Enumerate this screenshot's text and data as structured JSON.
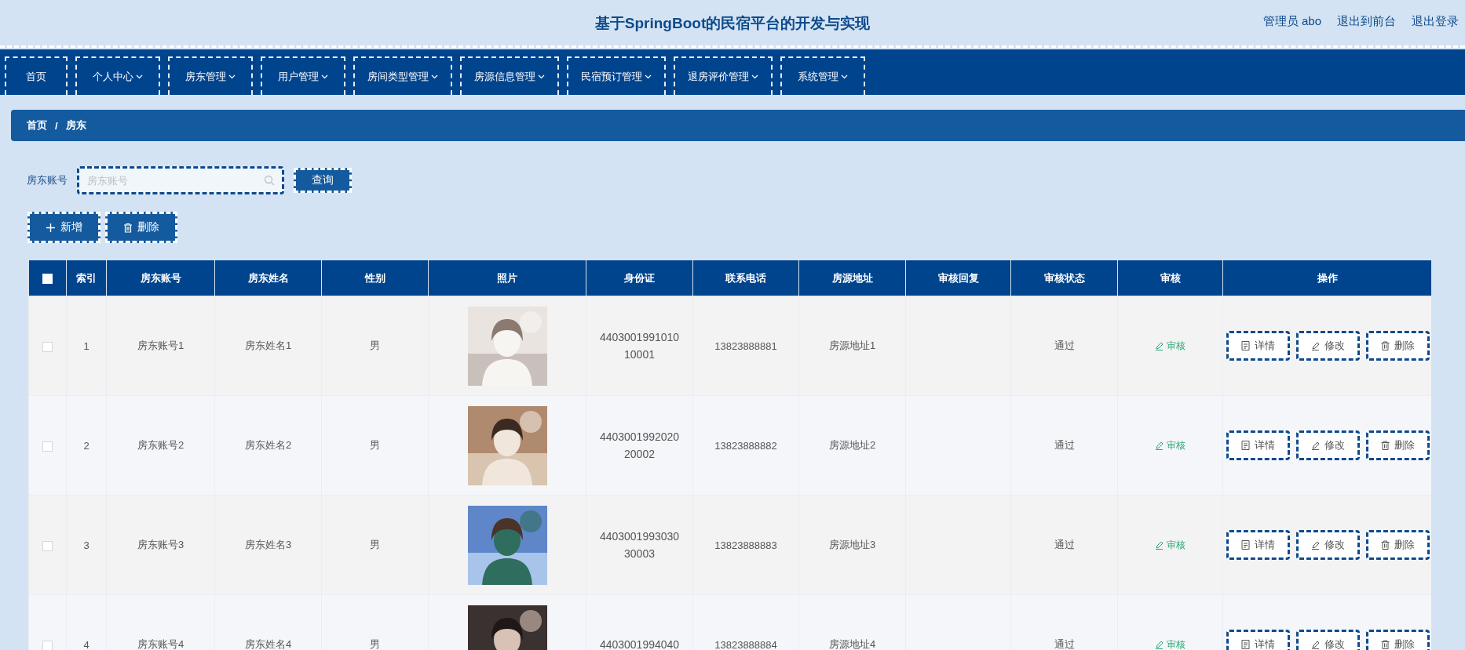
{
  "header": {
    "title": "基于SpringBoot的民宿平台的开发与实现",
    "links": [
      "管理员 abo",
      "退出到前台",
      "退出登录"
    ]
  },
  "nav": [
    {
      "label": "首页",
      "has_menu": false
    },
    {
      "label": "个人中心",
      "has_menu": true
    },
    {
      "label": "房东管理",
      "has_menu": true
    },
    {
      "label": "用户管理",
      "has_menu": true
    },
    {
      "label": "房间类型管理",
      "has_menu": true
    },
    {
      "label": "房源信息管理",
      "has_menu": true
    },
    {
      "label": "民宿预订管理",
      "has_menu": true
    },
    {
      "label": "退房评价管理",
      "has_menu": true
    },
    {
      "label": "系统管理",
      "has_menu": true
    }
  ],
  "breadcrumb": {
    "items": [
      "首页",
      "房东"
    ],
    "separator": "/"
  },
  "search": {
    "label": "房东账号",
    "placeholder": "房东账号",
    "button": "查询"
  },
  "actions": [
    {
      "kind": "add",
      "label": "新增"
    },
    {
      "kind": "delete",
      "label": "删除"
    }
  ],
  "table": {
    "all_checked": false,
    "columns": [
      "索引",
      "房东账号",
      "房东姓名",
      "性别",
      "照片",
      "身份证",
      "联系电话",
      "房源地址",
      "审核回复",
      "审核状态",
      "审核",
      "操作"
    ],
    "rows": [
      {
        "checked": false,
        "index": "1",
        "account": "房东账号1",
        "name": "房东姓名1",
        "gender": "男",
        "photo": {
          "kind": "picture"
        },
        "id_card": "440300199101010001",
        "phone": "13823888881",
        "address": "房源地址1",
        "status": "通过",
        "review": "审核",
        "ops": [
          "详情",
          "修改",
          "删除"
        ]
      },
      {
        "checked": false,
        "index": "2",
        "account": "房东账号2",
        "name": "房东姓名2",
        "gender": "男",
        "photo": {
          "kind": "picture"
        },
        "id_card": "440300199202020002",
        "phone": "13823888882",
        "address": "房源地址2",
        "status": "通过",
        "review": "审核",
        "ops": [
          "详情",
          "修改",
          "删除"
        ]
      },
      {
        "checked": false,
        "index": "3",
        "account": "房东账号3",
        "name": "房东姓名3",
        "gender": "男",
        "photo": {
          "kind": "picture"
        },
        "id_card": "440300199303030003",
        "phone": "13823888883",
        "address": "房源地址3",
        "status": "通过",
        "review": "审核",
        "ops": [
          "详情",
          "修改",
          "删除"
        ]
      },
      {
        "checked": false,
        "index": "4",
        "account": "房东账号4",
        "name": "房东姓名4",
        "gender": "男",
        "photo": {
          "kind": "picture"
        },
        "id_card": "4403001994040",
        "phone": "13823888884",
        "address": "房源地址4",
        "status": "通过",
        "review": "审核",
        "ops": [
          "详情",
          "修改",
          "删除"
        ]
      }
    ]
  }
}
